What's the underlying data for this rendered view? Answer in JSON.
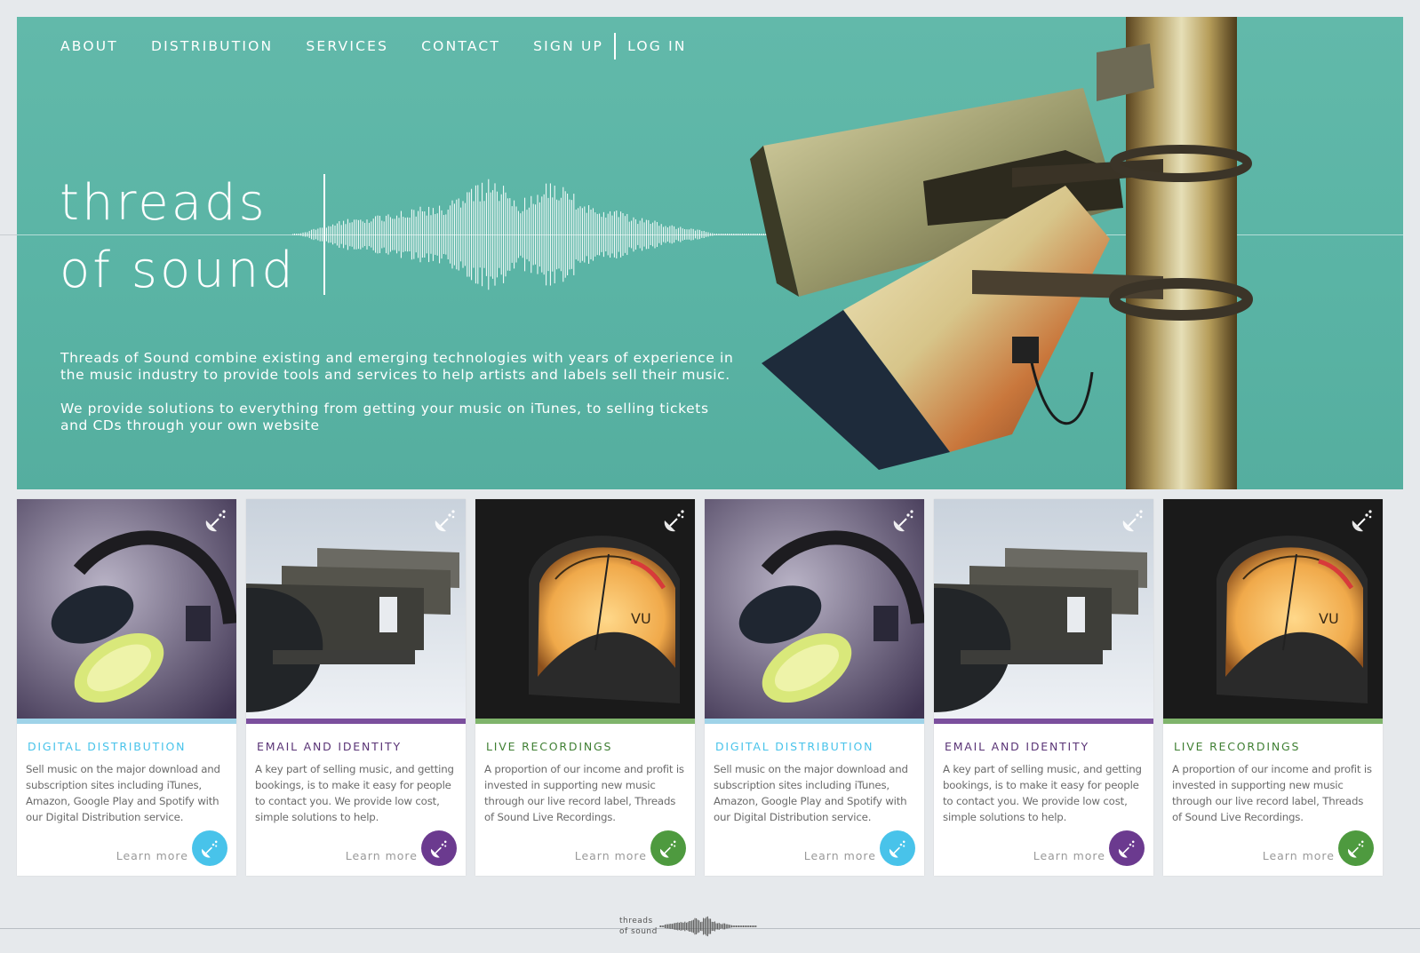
{
  "nav": {
    "items": [
      "ABOUT",
      "DISTRIBUTION",
      "SERVICES",
      "CONTACT",
      "SIGN UP"
    ],
    "login": "LOG IN"
  },
  "hero": {
    "logo_line1": "threads",
    "logo_line2": "of sound",
    "para1": "Threads of Sound combine existing and emerging technologies with years of experience in the music industry to provide tools and services to help artists and labels sell their music.",
    "para2": "We provide solutions to everything from getting your music on iTunes, to selling tickets and CDs through your own website"
  },
  "cards": [
    {
      "title": "DIGITAL DISTRIBUTION",
      "color": "#48c3ea",
      "desc": "Sell music on the major download and subscription sites including iTunes, Amazon, Google Play and Spotify with our Digital Distribution service.",
      "more": "Learn more",
      "image": "headphones"
    },
    {
      "title": "EMAIL AND IDENTITY",
      "color": "#6b3a8f",
      "desc": "A key part of selling music, and getting bookings, is to make it easy for people to contact you. We provide low cost, simple solutions to help.",
      "more": "Learn more",
      "image": "mailboxes"
    },
    {
      "title": "LIVE RECORDINGS",
      "color": "#4e9a3f",
      "desc": "A proportion of our income and profit is invested in supporting new music through our live record label, Threads of Sound Live Recordings.",
      "more": "Learn more",
      "image": "vu-meter"
    },
    {
      "title": "DIGITAL DISTRIBUTION",
      "color": "#48c3ea",
      "desc": "Sell music on the major download and subscription sites including iTunes, Amazon, Google Play and Spotify with our Digital Distribution service.",
      "more": "Learn more",
      "image": "headphones"
    },
    {
      "title": "EMAIL AND IDENTITY",
      "color": "#6b3a8f",
      "desc": "A key part of selling music, and getting bookings, is to make it easy for people to contact you. We provide low cost, simple solutions to help.",
      "more": "Learn more",
      "image": "mailboxes"
    },
    {
      "title": "LIVE RECORDINGS",
      "color": "#4e9a3f",
      "desc": "A proportion of our income and profit is invested in supporting new music through our live record label, Threads of Sound Live Recordings.",
      "more": "Learn more",
      "image": "vu-meter"
    }
  ],
  "footer": {
    "logo_line1": "threads",
    "logo_line2": "of sound"
  }
}
